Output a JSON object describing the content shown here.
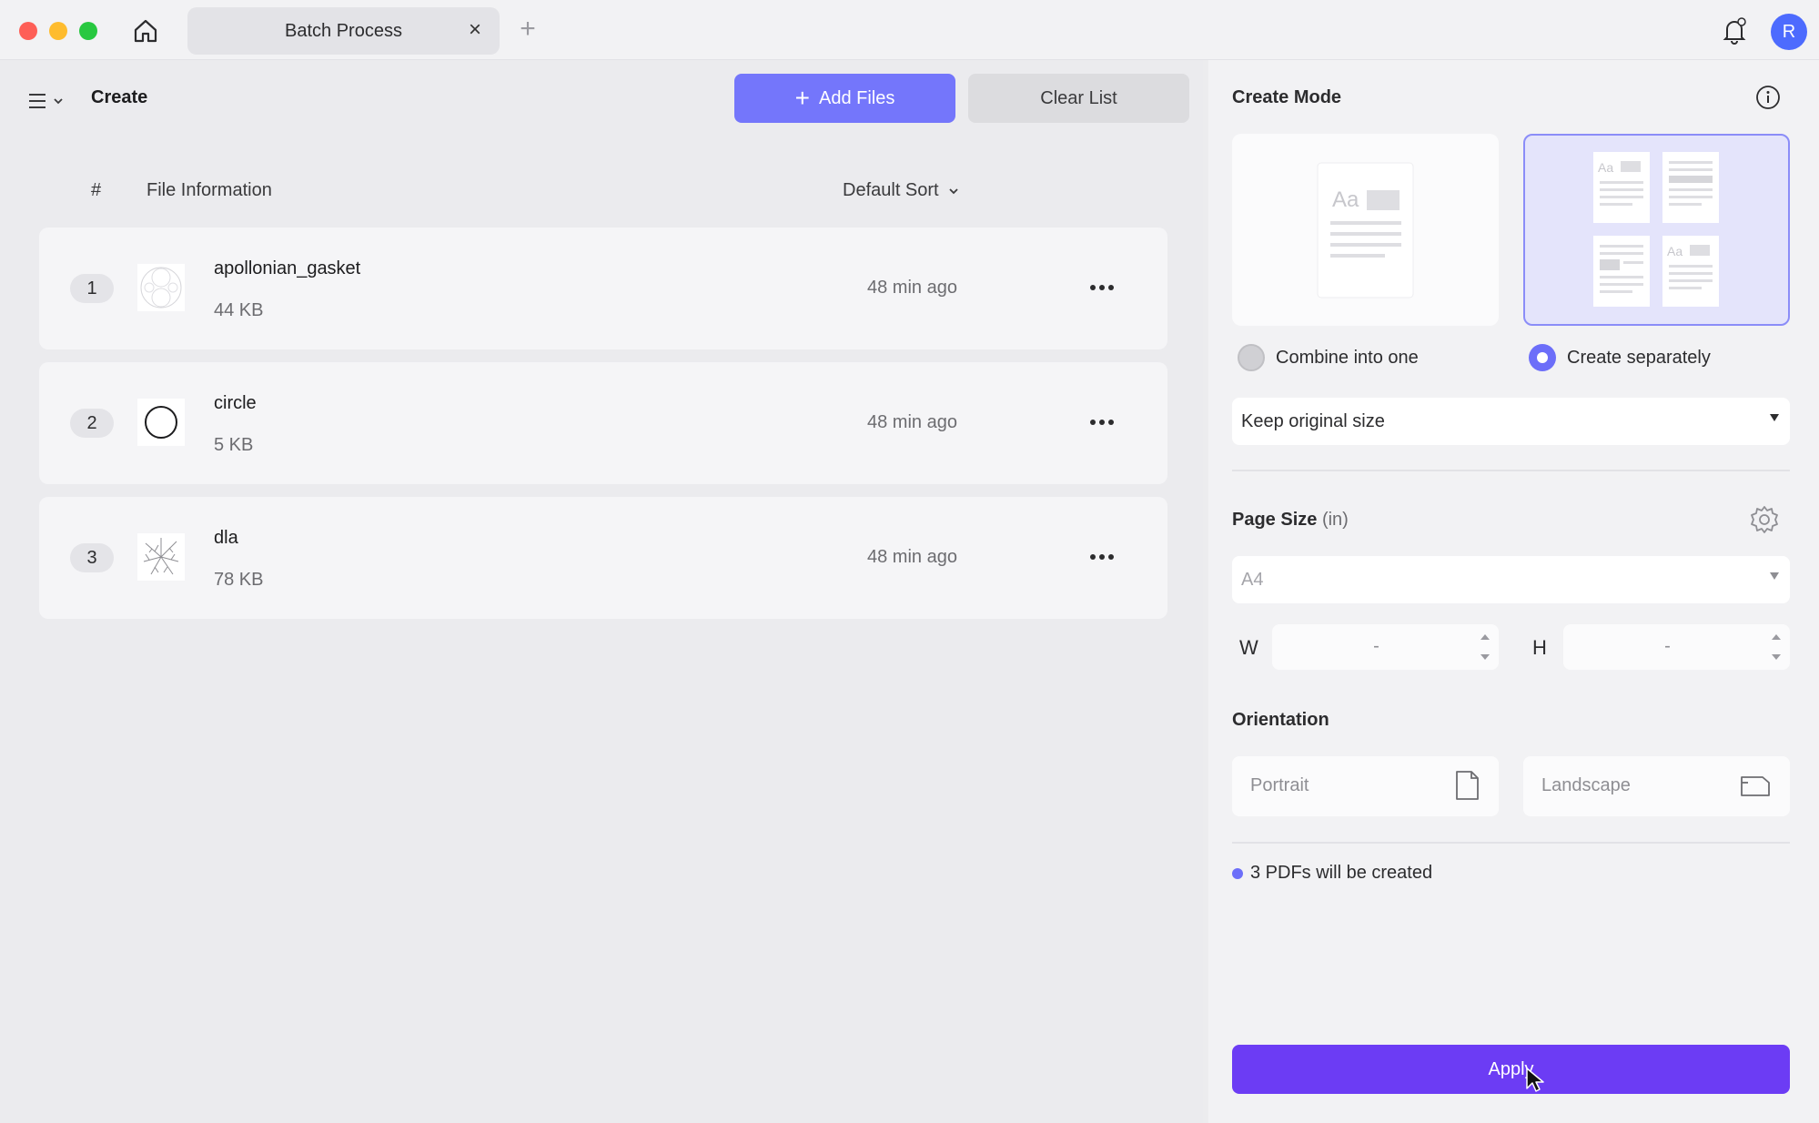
{
  "window": {
    "tab_title": "Batch Process",
    "tab_close": "×",
    "tab_add": "+",
    "avatar_initial": "R"
  },
  "left": {
    "title": "Create",
    "add_files_label": "Add Files",
    "add_files_icon": "+",
    "clear_list_label": "Clear List",
    "columns": {
      "index": "#",
      "info": "File Information",
      "sort": "Default Sort"
    },
    "files": [
      {
        "index": "1",
        "name": "apollonian_gasket",
        "size": "44 KB",
        "time": "48 min ago",
        "thumb_icon": "apollonian-gasket-thumbnail"
      },
      {
        "index": "2",
        "name": "circle",
        "size": "5 KB",
        "time": "48 min ago",
        "thumb_icon": "circle-thumbnail"
      },
      {
        "index": "3",
        "name": "dla",
        "size": "78 KB",
        "time": "48 min ago",
        "thumb_icon": "dla-fractal-thumbnail"
      }
    ]
  },
  "right": {
    "create_mode_title": "Create Mode",
    "mode_combine_label": "Combine into one",
    "mode_separate_label": "Create separately",
    "mode_selected": "Create separately",
    "size_option": "Keep original size",
    "page_size_title": "Page Size",
    "page_size_unit": "(in)",
    "page_size_value": "A4",
    "width_label": "W",
    "width_value": "-",
    "height_label": "H",
    "height_value": "-",
    "orientation_title": "Orientation",
    "portrait_label": "Portrait",
    "landscape_label": "Landscape",
    "status_text": "3 PDFs will be created",
    "apply_label": "Apply"
  },
  "colors": {
    "accent": "#7476fb",
    "apply": "#6c3cf4",
    "avatar": "#4d6bfe"
  }
}
